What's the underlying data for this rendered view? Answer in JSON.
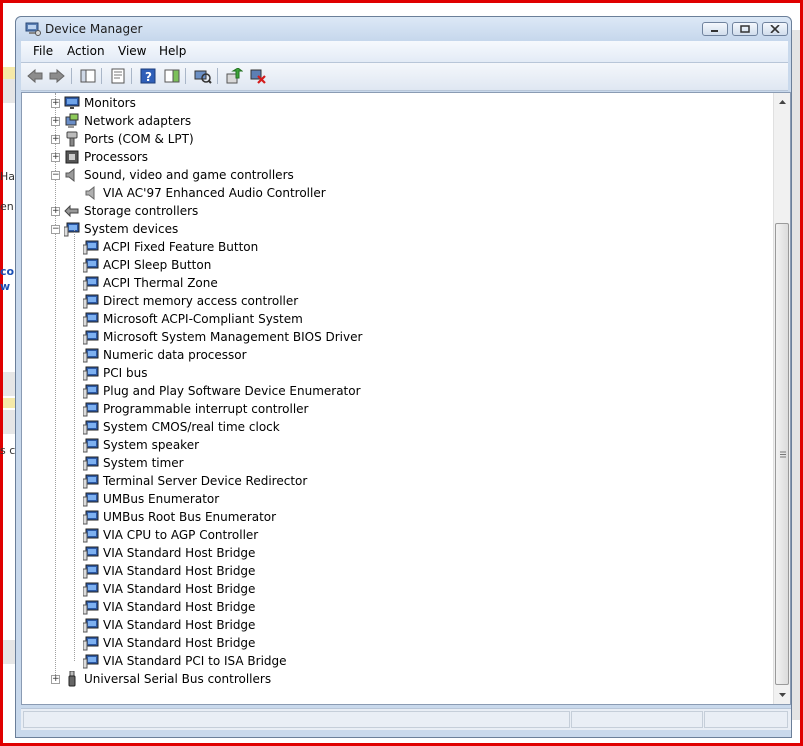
{
  "window": {
    "title": "Device Manager"
  },
  "menubar": {
    "items": [
      "File",
      "Action",
      "View",
      "Help"
    ]
  },
  "background_text": {
    "left": [
      "Ha",
      "en",
      "co",
      "w",
      "s c"
    ]
  },
  "tree": {
    "categories_top": [
      {
        "label": "Monitors",
        "icon": "monitor-icon"
      },
      {
        "label": "Network adapters",
        "icon": "network-adapter-icon"
      },
      {
        "label": "Ports (COM & LPT)",
        "icon": "port-icon"
      },
      {
        "label": "Processors",
        "icon": "processor-icon"
      },
      {
        "label": "Sound, video and game controllers",
        "icon": "speaker-icon",
        "expanded": true,
        "children": [
          "VIA AC'97 Enhanced Audio Controller"
        ]
      },
      {
        "label": "Storage controllers",
        "icon": "storage-icon"
      },
      {
        "label": "System devices",
        "icon": "system-device-icon",
        "expanded": true
      }
    ],
    "system_devices": [
      "ACPI Fixed Feature Button",
      "ACPI Sleep Button",
      "ACPI Thermal Zone",
      "Direct memory access controller",
      "Microsoft ACPI-Compliant System",
      "Microsoft System Management BIOS Driver",
      "Numeric data processor",
      "PCI bus",
      "Plug and Play Software Device Enumerator",
      "Programmable interrupt controller",
      "System CMOS/real time clock",
      "System speaker",
      "System timer",
      "Terminal Server Device Redirector",
      "UMBus Enumerator",
      "UMBus Root Bus Enumerator",
      "VIA CPU to AGP Controller",
      "VIA Standard Host Bridge",
      "VIA Standard Host Bridge",
      "VIA Standard Host Bridge",
      "VIA Standard Host Bridge",
      "VIA Standard Host Bridge",
      "VIA Standard Host Bridge",
      "VIA Standard PCI to ISA Bridge"
    ],
    "categories_bottom": [
      {
        "label": "Universal Serial Bus controllers",
        "icon": "usb-icon"
      }
    ]
  },
  "colors": {
    "frame_red": "#e00000",
    "window_chrome": "#c9d9ec",
    "link_blue": "#1a4fb5"
  }
}
